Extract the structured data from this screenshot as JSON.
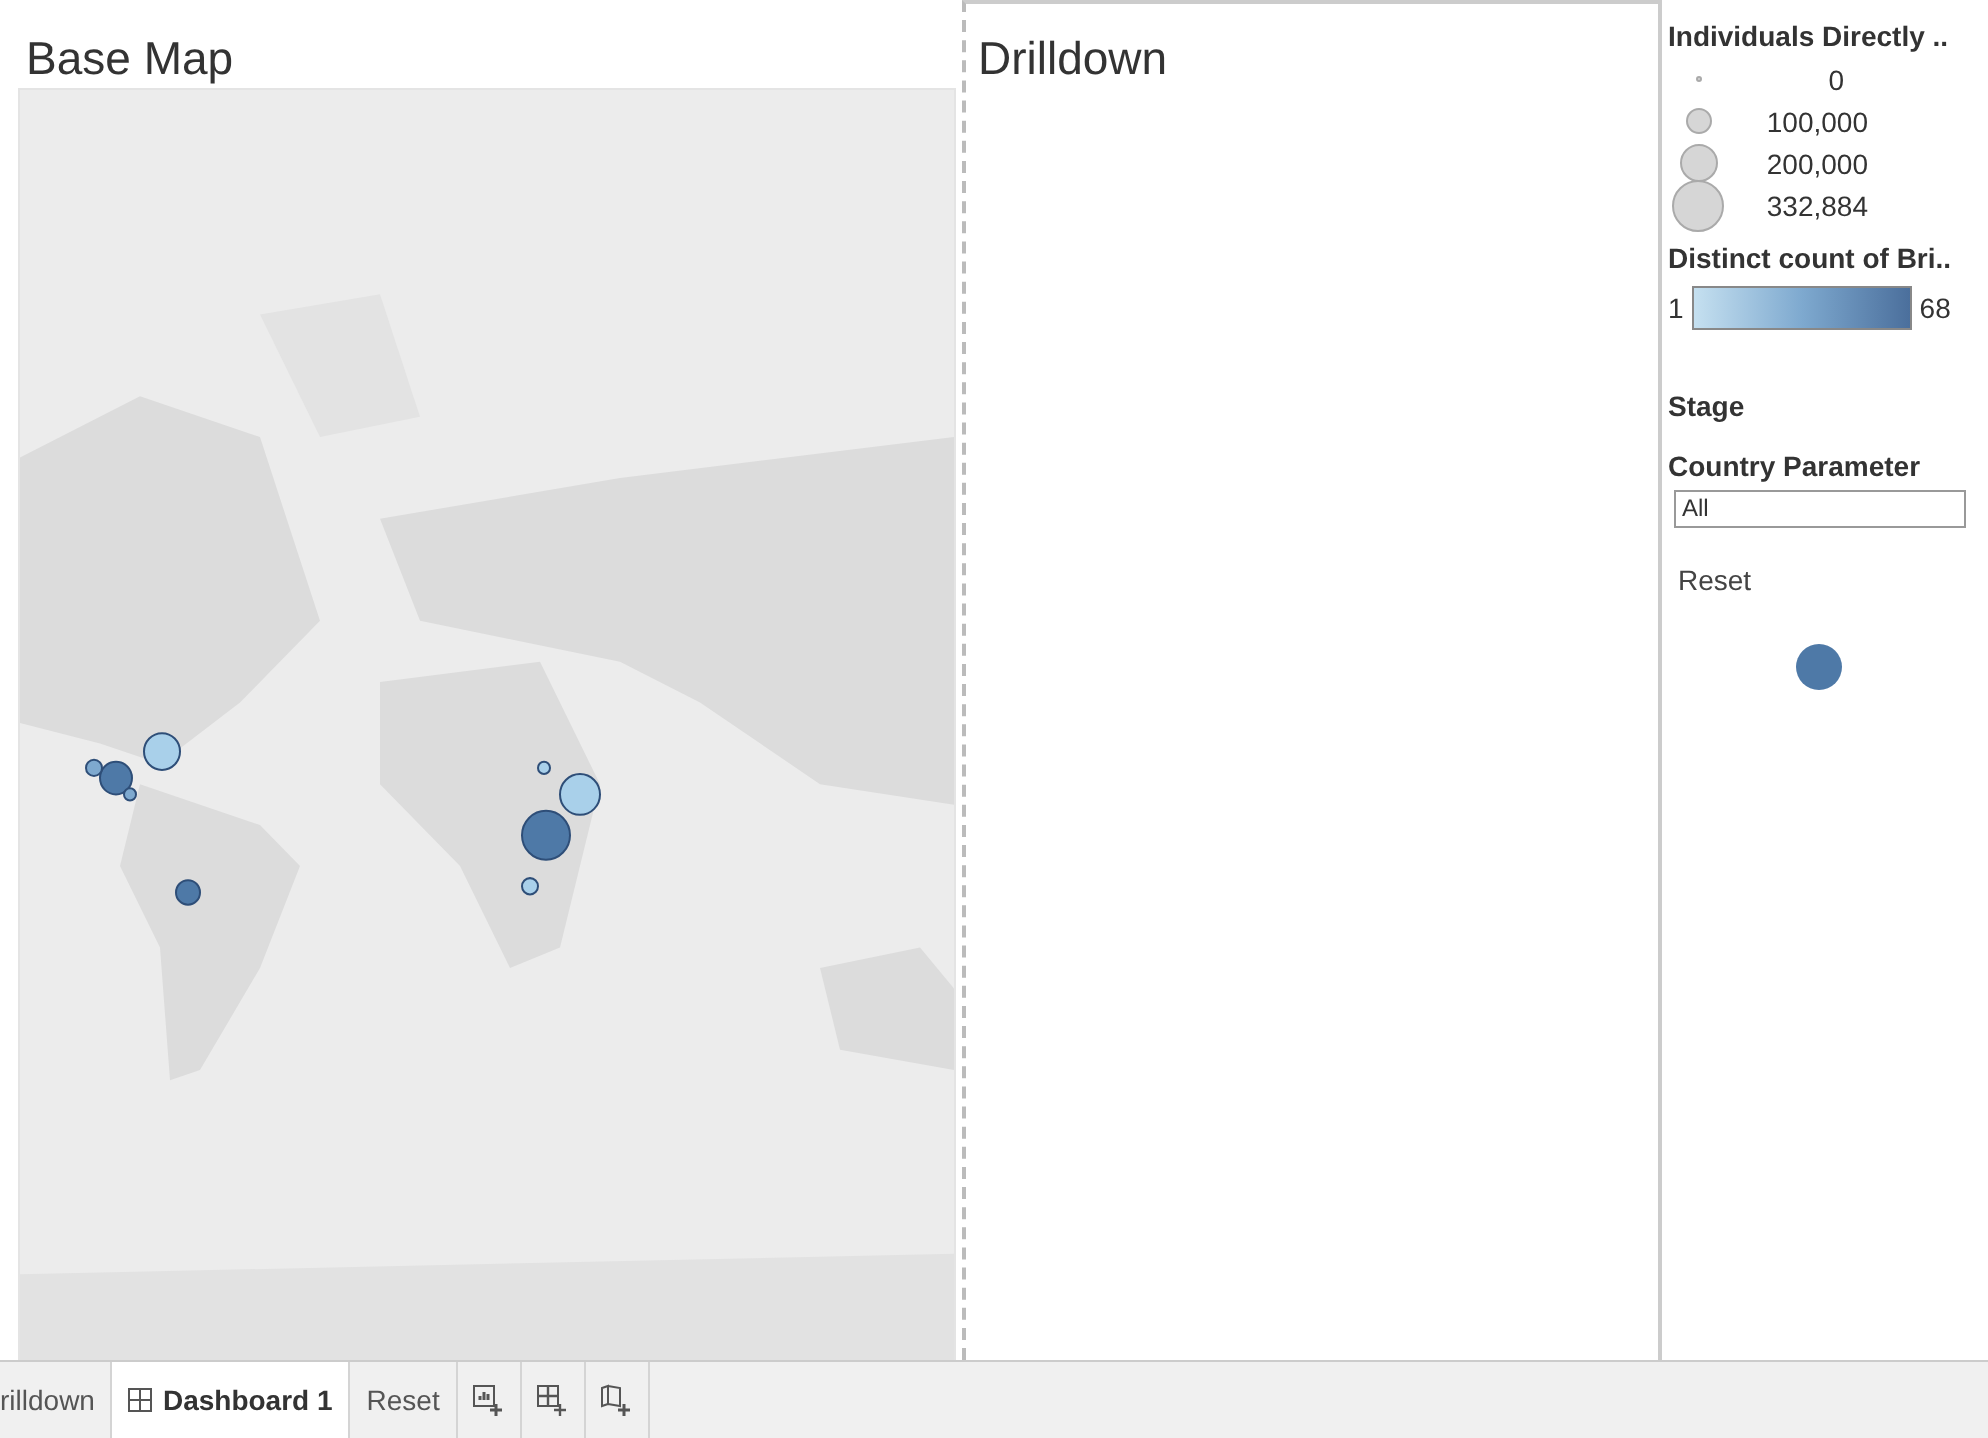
{
  "map": {
    "title": "Base Map"
  },
  "drilldown": {
    "title": "Drilldown"
  },
  "legend": {
    "size_title": "Individuals Directly ..",
    "size_items": [
      "0",
      "100,000",
      "200,000",
      "332,884"
    ],
    "color_title": "Distinct count of Bri..",
    "color_min": "1",
    "color_max": "68",
    "stage_label": "Stage",
    "parameter_label": "Country Parameter",
    "parameter_value": "All",
    "reset_label": "Reset"
  },
  "tabs": [
    {
      "label": "rilldown",
      "kind": "sheet",
      "selected": false
    },
    {
      "label": "Dashboard 1",
      "kind": "dashboard",
      "selected": true
    },
    {
      "label": "Reset",
      "kind": "sheet",
      "selected": false
    }
  ]
}
